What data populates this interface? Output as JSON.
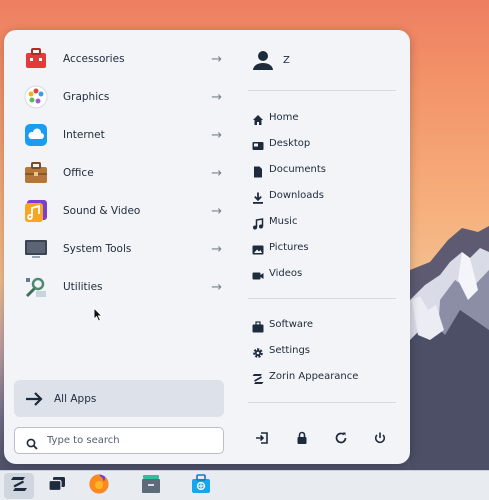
{
  "menu": {
    "categories": [
      {
        "label": "Accessories",
        "icon": "toolbox-icon"
      },
      {
        "label": "Graphics",
        "icon": "palette-icon"
      },
      {
        "label": "Internet",
        "icon": "cloud-icon"
      },
      {
        "label": "Office",
        "icon": "briefcase-icon"
      },
      {
        "label": "Sound & Video",
        "icon": "music-icon"
      },
      {
        "label": "System Tools",
        "icon": "monitor-icon"
      },
      {
        "label": "Utilities",
        "icon": "utilities-icon"
      }
    ],
    "arrow": "→",
    "all_apps": "All Apps",
    "search_placeholder": "Type to search"
  },
  "user": {
    "name": "Z"
  },
  "places": [
    {
      "label": "Home"
    },
    {
      "label": "Desktop"
    },
    {
      "label": "Documents"
    },
    {
      "label": "Downloads"
    },
    {
      "label": "Music"
    },
    {
      "label": "Pictures"
    },
    {
      "label": "Videos"
    }
  ],
  "system": [
    {
      "label": "Software"
    },
    {
      "label": "Settings"
    },
    {
      "label": "Zorin Appearance"
    }
  ],
  "colors": {
    "accent": "#15a6f0",
    "text": "#1f2a3a",
    "menu_bg": "#f2f4f8"
  }
}
